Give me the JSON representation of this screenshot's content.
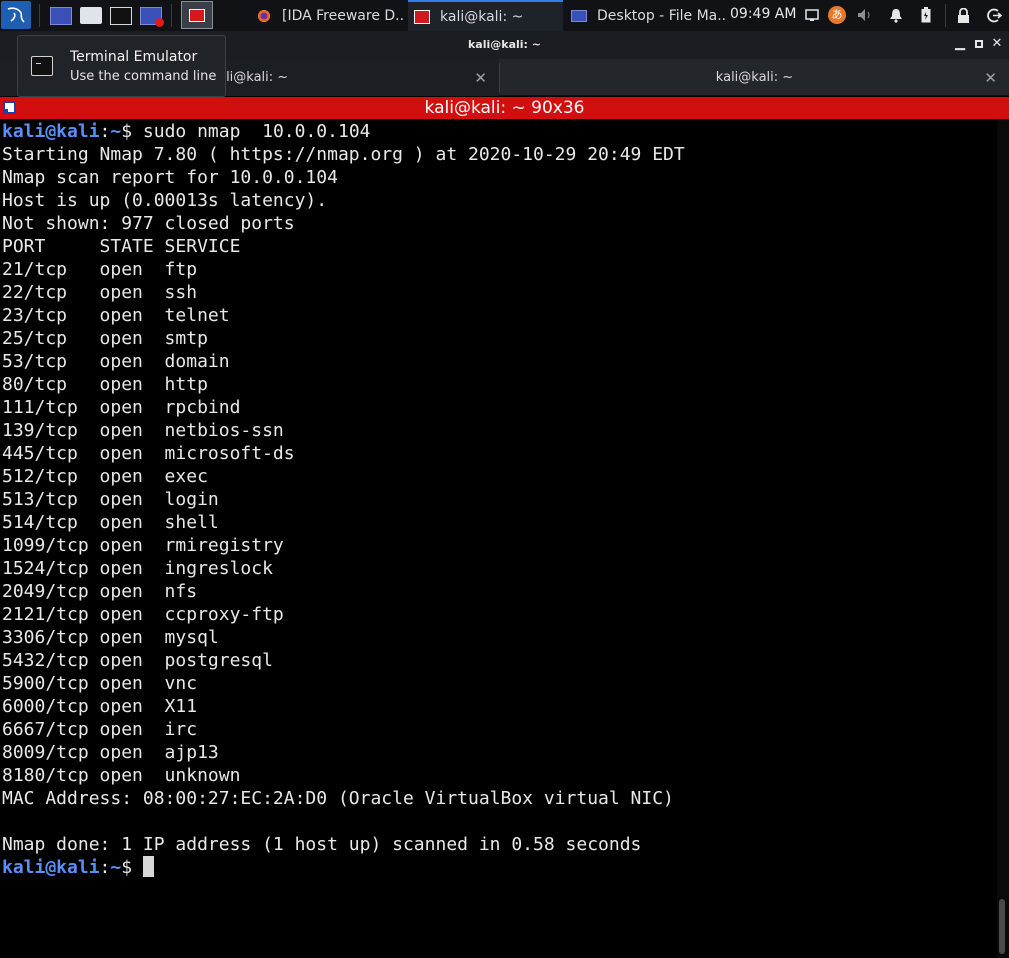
{
  "panel": {
    "clock": "09:49 AM",
    "tasks": [
      {
        "label": "[IDA Freeware D...",
        "icon": "firefox-icon"
      },
      {
        "label": "kali@kali: ~",
        "icon": "terminal-icon"
      },
      {
        "label": "Desktop - File Ma...",
        "icon": "folder-icon"
      }
    ]
  },
  "window": {
    "title": "kali@kali: ~"
  },
  "tooltip": {
    "title": "Terminal Emulator",
    "description": "Use the command line"
  },
  "tabs": [
    {
      "label": "kali@kali: ~"
    },
    {
      "label": "kali@kali: ~"
    }
  ],
  "terminal": {
    "header": "kali@kali: ~ 90x36",
    "prompt_user": "kali@kali",
    "prompt_sep": ":",
    "prompt_path": "~",
    "prompt_dollar": "$",
    "command": " sudo nmap  10.0.0.104",
    "output": [
      "Starting Nmap 7.80 ( https://nmap.org ) at 2020-10-29 20:49 EDT",
      "Nmap scan report for 10.0.0.104",
      "Host is up (0.00013s latency).",
      "Not shown: 977 closed ports",
      "PORT     STATE SERVICE",
      "21/tcp   open  ftp",
      "22/tcp   open  ssh",
      "23/tcp   open  telnet",
      "25/tcp   open  smtp",
      "53/tcp   open  domain",
      "80/tcp   open  http",
      "111/tcp  open  rpcbind",
      "139/tcp  open  netbios-ssn",
      "445/tcp  open  microsoft-ds",
      "512/tcp  open  exec",
      "513/tcp  open  login",
      "514/tcp  open  shell",
      "1099/tcp open  rmiregistry",
      "1524/tcp open  ingreslock",
      "2049/tcp open  nfs",
      "2121/tcp open  ccproxy-ftp",
      "3306/tcp open  mysql",
      "5432/tcp open  postgresql",
      "5900/tcp open  vnc",
      "6000/tcp open  X11",
      "6667/tcp open  irc",
      "8009/tcp open  ajp13",
      "8180/tcp open  unknown",
      "MAC Address: 08:00:27:EC:2A:D0 (Oracle VirtualBox virtual NIC)",
      "",
      "Nmap done: 1 IP address (1 host up) scanned in 0.58 seconds"
    ]
  }
}
